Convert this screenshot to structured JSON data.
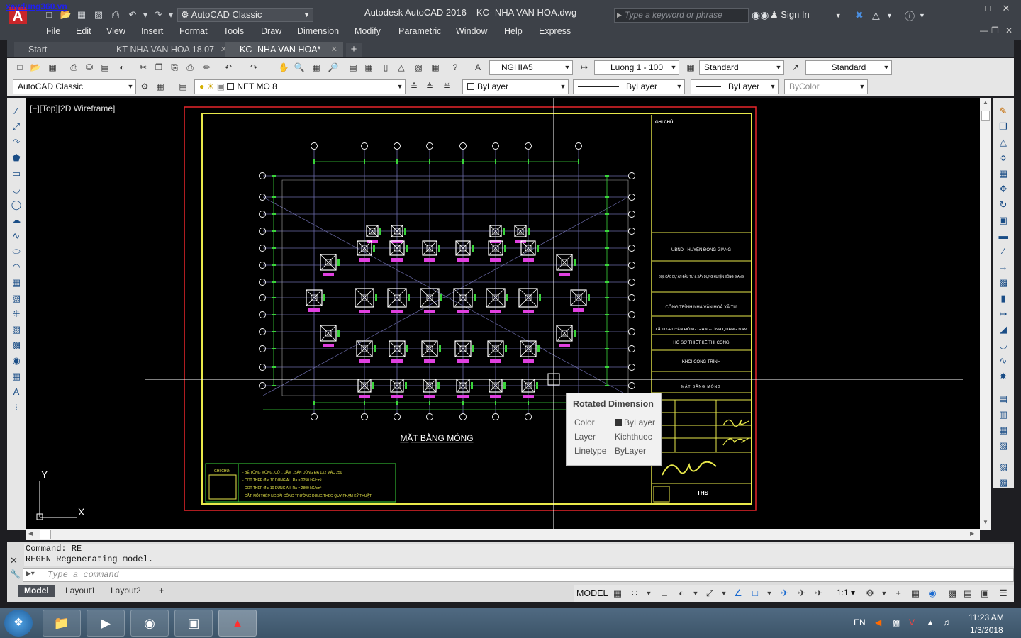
{
  "titlebar": {
    "watermark": "xaydung360.vn",
    "workspace": "AutoCAD Classic",
    "app_name": "Autodesk AutoCAD 2016",
    "file_name": "KC- NHA VAN HOA.dwg",
    "search_placeholder": "Type a keyword or phrase",
    "sign_in": "Sign In"
  },
  "menu": [
    "File",
    "Edit",
    "View",
    "Insert",
    "Format",
    "Tools",
    "Draw",
    "Dimension",
    "Modify",
    "Parametric",
    "Window",
    "Help",
    "Express"
  ],
  "file_tabs": [
    {
      "label": "Start"
    },
    {
      "label": "KT-NHA VAN HOA 18.07"
    },
    {
      "label": "KC- NHA VAN HOA*"
    }
  ],
  "toolbar1": {
    "text_style": "NGHIA5",
    "dim_style": "Luong 1 - 100",
    "table_style": "Standard",
    "mleader_style": "Standard"
  },
  "toolbar2": {
    "workspace": "AutoCAD Classic",
    "layer": "NET MO 8",
    "color": "ByLayer",
    "linetype": "ByLayer",
    "lineweight": "ByLayer",
    "plotstyle": "ByColor"
  },
  "viewport": {
    "label": "[−][Top][2D Wireframe]",
    "ucs_x": "X",
    "ucs_y": "Y"
  },
  "drawing": {
    "plan_title": "MẶT BẰNG MÓNG",
    "notes_title": "GHI CHÚ:",
    "notes": [
      "- BÊ TÔNG MÓNG, CỘT, DẦM , SÀN DÙNG ĐÁ 1X2 MÁC 250",
      "- CỐT THÉP Ø < 10 DÙNG AI : Ra = 2250 kG/cm²",
      "- CỐT THÉP Ø ≥ 10 DÙNG AII: Ra = 2800 kG/cm²",
      "- CẮT, NỐI THÉP NGOÀI CÔNG TRƯỜNG ĐÚNG THEO QUY PHẠM KỸ THUẬT"
    ],
    "title_block": {
      "header": "GHI CHÚ:",
      "owner": "UBND - HUYỆN ĐÔNG GIANG",
      "pmu": "BQL CÁC DỰ ÁN ĐẦU TƯ & XÂY DỰNG HUYỆN ĐÔNG GIANG",
      "project": "CÔNG TRÌNH NHÀ VĂN HOÁ XÃ TƯ",
      "location": "XÃ TƯ-HUYỆN ĐÔNG GIANG-TỈNH QUẢNG NAM",
      "stage": "HỒ SƠ THIẾT KẾ THI CÔNG",
      "item": "KHỐI CÔNG TRÌNH",
      "sheet": "MẶT BẰNG MÓNG",
      "company": "THS"
    }
  },
  "tooltip": {
    "title": "Rotated Dimension",
    "rows": [
      {
        "key": "Color",
        "value": "ByLayer"
      },
      {
        "key": "Layer",
        "value": "Kichthuoc"
      },
      {
        "key": "Linetype",
        "value": "ByLayer"
      }
    ]
  },
  "command": {
    "history": [
      "Command: RE",
      "REGEN Regenerating model."
    ],
    "placeholder": "Type a command"
  },
  "layout_tabs": [
    "Model",
    "Layout1",
    "Layout2"
  ],
  "status": {
    "model": "MODEL",
    "scale": "1:1"
  },
  "taskbar": {
    "lang": "EN",
    "time": "11:23 AM",
    "date": "1/3/2018"
  },
  "colors": {
    "background": "#000000",
    "frame_red": "#e8262a",
    "frame_yellow": "#e8e84a",
    "dimension": "#3ad53a",
    "grid": "#6a6aa8",
    "tag": "#e040e0"
  }
}
